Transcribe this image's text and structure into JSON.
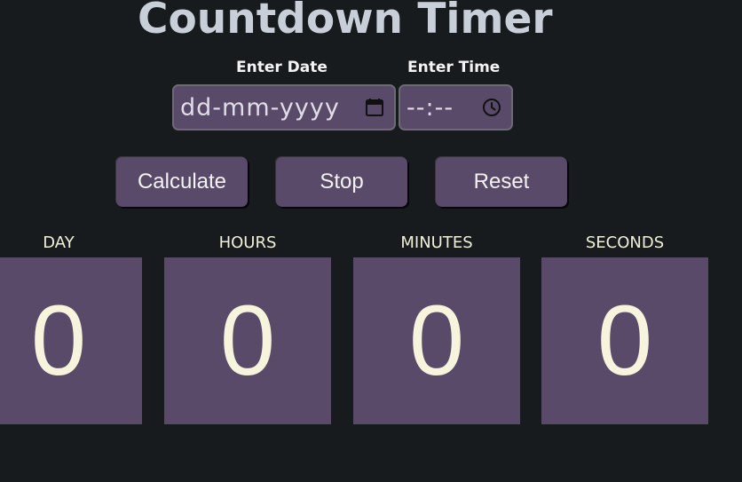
{
  "header": {
    "title": "Countdown Timer"
  },
  "form": {
    "date_label": "Enter Date",
    "date_value": "dd-mm-yyyy",
    "date_icon": "calendar-icon",
    "time_label": "Enter Time",
    "time_value": "--:--",
    "time_icon": "clock-icon"
  },
  "buttons": {
    "calculate": "Calculate",
    "stop": "Stop",
    "reset": "Reset"
  },
  "countdown": {
    "units": [
      {
        "label": "DAY",
        "value": "0"
      },
      {
        "label": "HOURS",
        "value": "0"
      },
      {
        "label": "MINUTES",
        "value": "0"
      },
      {
        "label": "SECONDS",
        "value": "0"
      }
    ]
  },
  "colors": {
    "background": "#171b1e",
    "panel": "#5a4a6a",
    "title": "#c8cfd8",
    "digits": "#f6f4dc"
  }
}
